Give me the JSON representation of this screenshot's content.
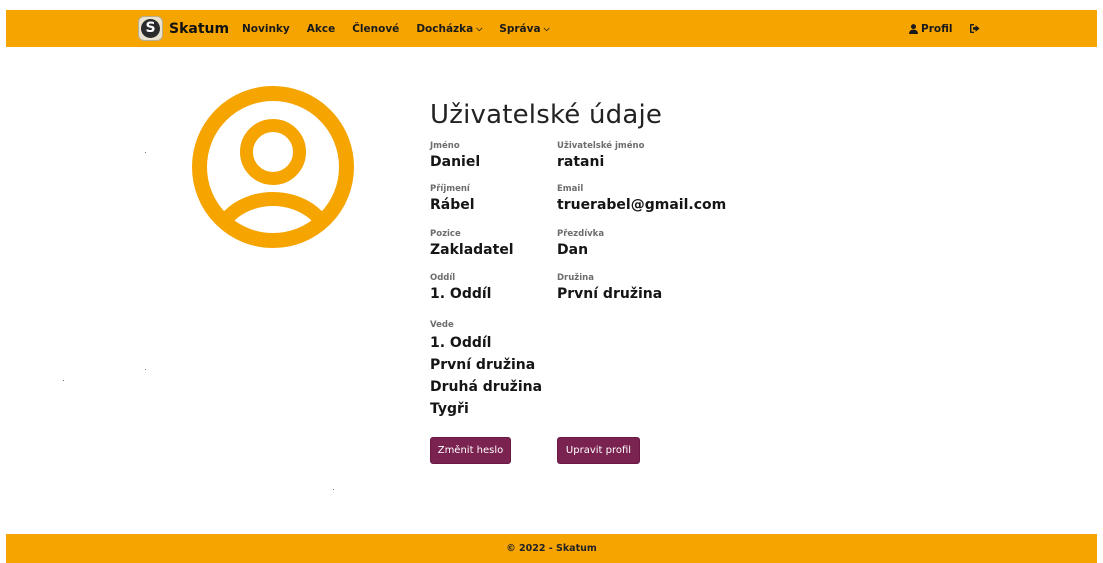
{
  "brand": {
    "name": "Skatum",
    "logo_letter": "S"
  },
  "nav": {
    "items": [
      {
        "label": "Novinky"
      },
      {
        "label": "Akce"
      },
      {
        "label": "Členové"
      },
      {
        "label": "Docházka",
        "dropdown": true
      },
      {
        "label": "Správa",
        "dropdown": true
      }
    ],
    "profile_label": "Profil",
    "profile_icon": "user-icon",
    "logout_icon": "sign-out-icon"
  },
  "profile": {
    "title": "Uživatelské údaje",
    "first_name": {
      "label": "Jméno",
      "value": "Daniel"
    },
    "username": {
      "label": "Uživatelské jméno",
      "value": "ratani"
    },
    "last_name": {
      "label": "Příjmení",
      "value": "Rábel"
    },
    "email": {
      "label": "Email",
      "value": "truerabel@gmail.com"
    },
    "position": {
      "label": "Pozice",
      "value": "Zakladatel"
    },
    "nickname": {
      "label": "Přezdívka",
      "value": "Dan"
    },
    "unit": {
      "label": "Oddíl",
      "value": "1. Oddíl"
    },
    "patrol": {
      "label": "Družina",
      "value": "První družina"
    },
    "leads": {
      "label": "Vede",
      "values": [
        "1. Oddíl",
        "První družina",
        "Druhá družina",
        "Tygři"
      ]
    },
    "change_password": "Změnit heslo",
    "edit_profile": "Upravit profil"
  },
  "colors": {
    "accent": "#f5a400",
    "button": "#7a2350"
  },
  "footer": {
    "text": "© 2022 - Skatum"
  }
}
